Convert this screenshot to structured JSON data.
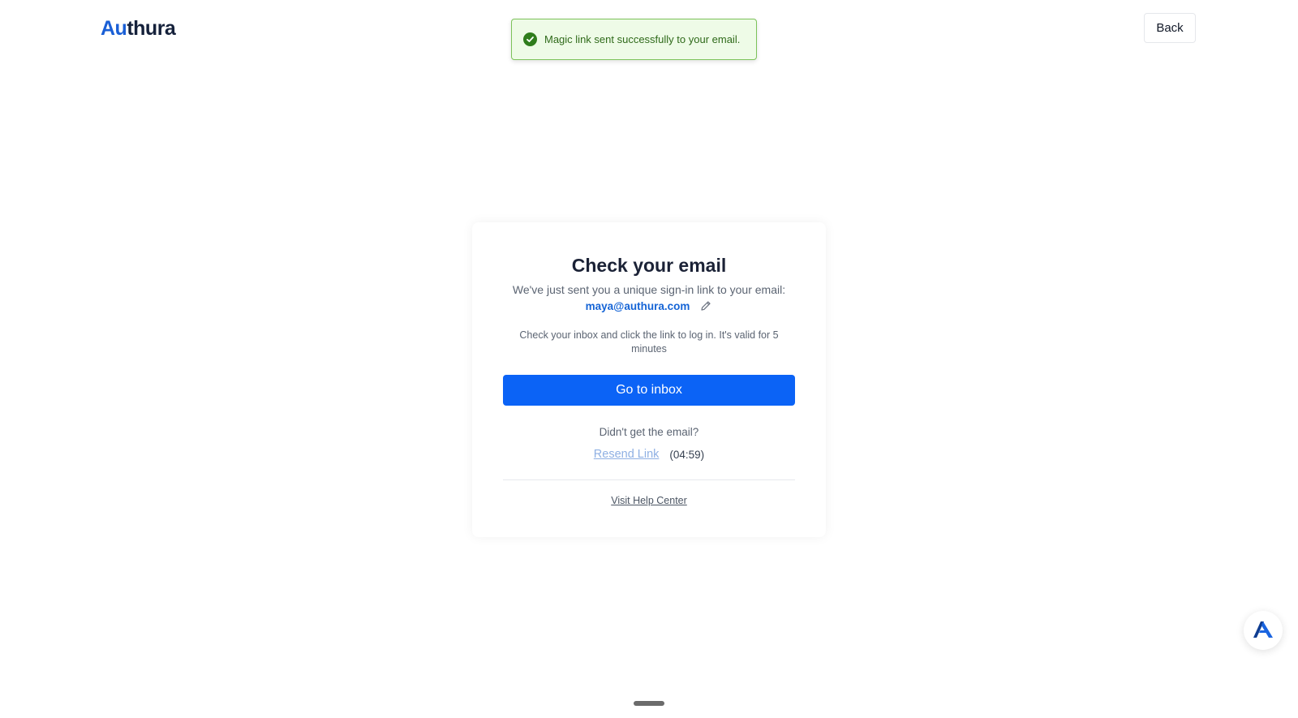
{
  "header": {
    "logo_text_accent": "Au",
    "logo_text_rest": "thura",
    "back_label": "Back"
  },
  "toast": {
    "message": "Magic link sent successfully to your email.",
    "icon": "check-circle-icon",
    "status_color": "#2f7d1c"
  },
  "card": {
    "title": "Check your email",
    "subtitle": "We've just sent you a unique sign-in link to your email:",
    "email": "maya@authura.com",
    "note": "Check your inbox and click the link to log in. It's valid for 5 minutes",
    "primary_button_label": "Go to inbox",
    "didnt_get_text": "Didn't get the email?",
    "resend_label": "Resend Link",
    "timer": "(04:59)",
    "help_link": "Visit Help Center"
  },
  "colors": {
    "accent": "#0b63f6",
    "brand_dark": "#15213b",
    "brand_blue": "#1a5fd6",
    "toast_bg": "#eefbe7",
    "toast_border": "#7cc35a"
  },
  "icons": {
    "edit": "pencil-icon",
    "chat": "chat-widget-icon"
  }
}
